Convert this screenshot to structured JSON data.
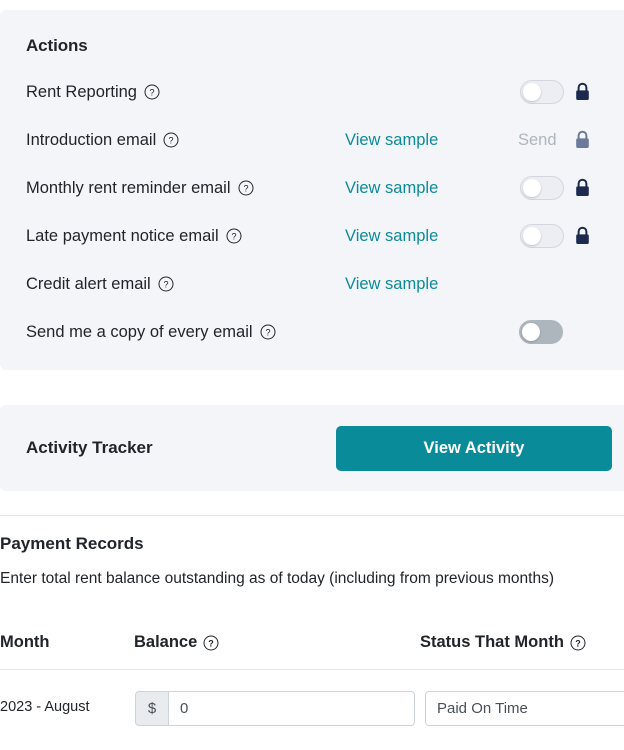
{
  "actions": {
    "title": "Actions",
    "rows": [
      {
        "label": "Rent Reporting",
        "help": "help-icon",
        "link": null,
        "send_text": null,
        "toggle": "off",
        "lock": "dark"
      },
      {
        "label": "Introduction email",
        "help": "help-icon",
        "link": "View sample",
        "send_text": "Send",
        "toggle": null,
        "lock": "muted"
      },
      {
        "label": "Monthly rent reminder email",
        "help": "help-icon",
        "link": "View sample",
        "send_text": null,
        "toggle": "off",
        "lock": "dark"
      },
      {
        "label": "Late payment notice email",
        "help": "help-icon",
        "link": "View sample",
        "send_text": null,
        "toggle": "off",
        "lock": "dark"
      },
      {
        "label": "Credit alert email",
        "help": "help-icon",
        "link": "View sample",
        "send_text": null,
        "toggle": null,
        "lock": null
      },
      {
        "label": "Send me a copy of every email",
        "help": "help-icon",
        "link": null,
        "send_text": null,
        "toggle": "off-dark",
        "lock": null
      }
    ]
  },
  "activity": {
    "title": "Activity Tracker",
    "button_label": "View Activity"
  },
  "payment_records": {
    "title": "Payment Records",
    "description": "Enter total rent balance outstanding as of today (including from previous months)",
    "columns": {
      "month": "Month",
      "balance": "Balance",
      "status": "Status That Month"
    },
    "rows": [
      {
        "month": "2023 - August",
        "currency_prefix": "$",
        "balance_value": "0",
        "status_value": "Paid On Time"
      }
    ]
  },
  "colors": {
    "accent_teal": "#0a8b9a",
    "link_teal": "#0d8a99",
    "card_bg": "#f4f5f9",
    "lock_dark": "#1b2a4e",
    "lock_muted": "#6b7a99",
    "toggle_track": "#eceef3",
    "toggle_track_dark": "#adb5bd"
  }
}
